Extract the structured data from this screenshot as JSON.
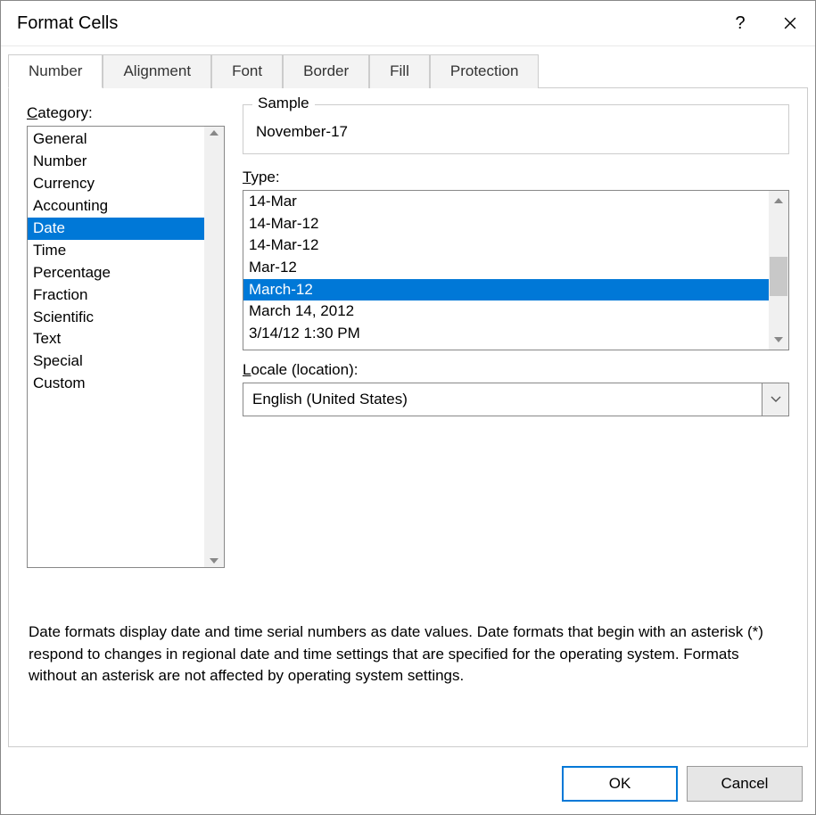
{
  "window": {
    "title": "Format Cells"
  },
  "tabs": [
    {
      "label": "Number",
      "active": true
    },
    {
      "label": "Alignment",
      "active": false
    },
    {
      "label": "Font",
      "active": false
    },
    {
      "label": "Border",
      "active": false
    },
    {
      "label": "Fill",
      "active": false
    },
    {
      "label": "Protection",
      "active": false
    }
  ],
  "category": {
    "label_pre": "C",
    "label_post": "ategory:",
    "items": [
      {
        "label": "General",
        "selected": false
      },
      {
        "label": "Number",
        "selected": false
      },
      {
        "label": "Currency",
        "selected": false
      },
      {
        "label": "Accounting",
        "selected": false
      },
      {
        "label": "Date",
        "selected": true
      },
      {
        "label": "Time",
        "selected": false
      },
      {
        "label": "Percentage",
        "selected": false
      },
      {
        "label": "Fraction",
        "selected": false
      },
      {
        "label": "Scientific",
        "selected": false
      },
      {
        "label": "Text",
        "selected": false
      },
      {
        "label": "Special",
        "selected": false
      },
      {
        "label": "Custom",
        "selected": false
      }
    ]
  },
  "sample": {
    "legend": "Sample",
    "value": "November-17"
  },
  "type": {
    "label_pre": "T",
    "label_post": "ype:",
    "items": [
      {
        "label": "14-Mar",
        "selected": false
      },
      {
        "label": "14-Mar-12",
        "selected": false
      },
      {
        "label": "14-Mar-12",
        "selected": false
      },
      {
        "label": "Mar-12",
        "selected": false
      },
      {
        "label": "March-12",
        "selected": true
      },
      {
        "label": "March 14, 2012",
        "selected": false
      },
      {
        "label": "3/14/12 1:30 PM",
        "selected": false
      }
    ]
  },
  "locale": {
    "label_pre": "L",
    "label_post": "ocale (location):",
    "value": "English (United States)"
  },
  "description": "Date formats display date and time serial numbers as date values.  Date formats that begin with an asterisk (*) respond to changes in regional date and time settings that are specified for the operating system. Formats without an asterisk are not affected by operating system settings.",
  "buttons": {
    "ok": "OK",
    "cancel": "Cancel"
  }
}
